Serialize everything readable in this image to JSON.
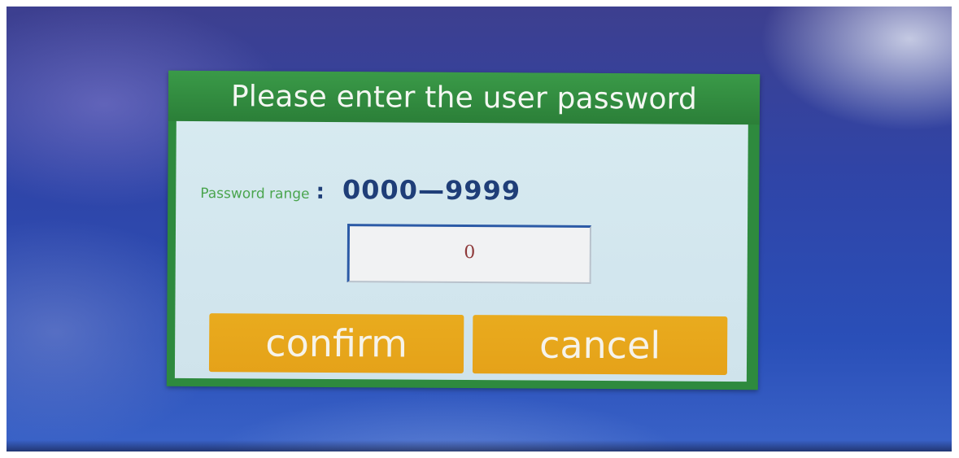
{
  "dialog": {
    "title": "Please enter the user password",
    "range_label": "Password range",
    "range_separator": ":",
    "range_value": "0000—9999",
    "password_input": {
      "value": "0"
    },
    "buttons": {
      "confirm_label": "confirm",
      "cancel_label": "cancel"
    }
  },
  "colors": {
    "title_bar": "#2e8a3e",
    "body_background": "#d7eaf0",
    "range_label": "#4aa54e",
    "range_value": "#1f3e78",
    "button": "#e9ab1e",
    "button_text": "#f6f3ea",
    "input_text": "#8e3a3a",
    "desktop_background": "#2f45a8"
  }
}
